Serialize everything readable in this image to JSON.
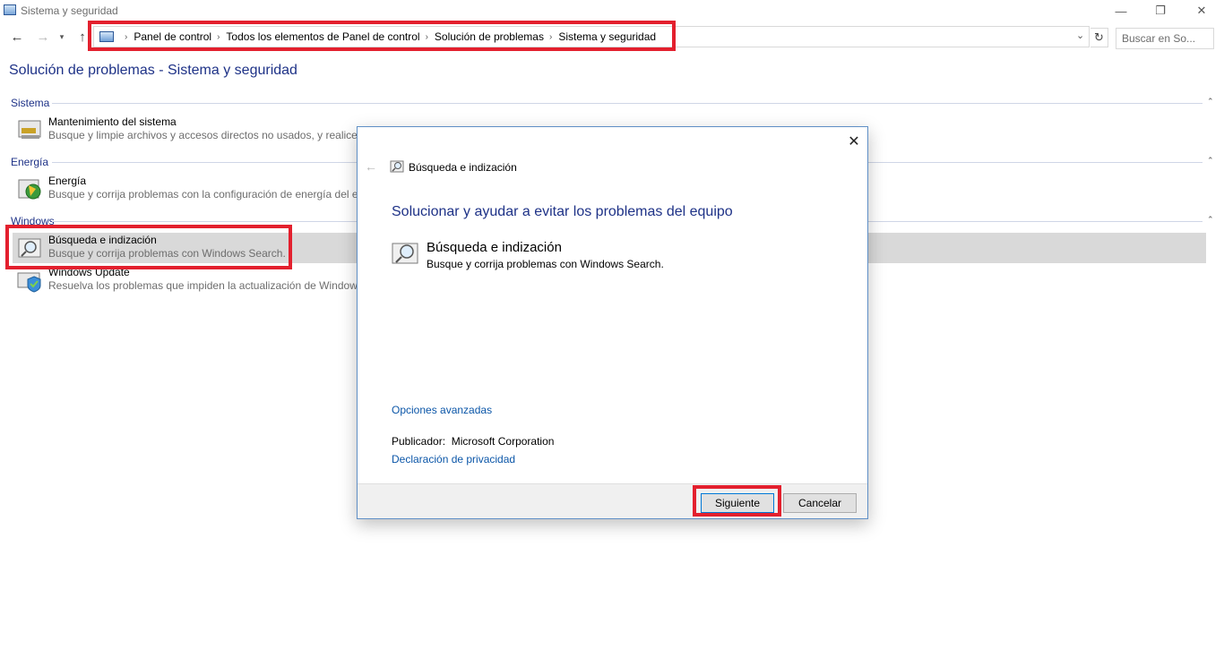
{
  "window": {
    "title": "Sistema y seguridad",
    "minimize_glyph": "—",
    "maximize_glyph": "❐",
    "close_glyph": "✕"
  },
  "navigation": {
    "back_glyph": "←",
    "forward_glyph": "→",
    "recent_glyph": "▾",
    "up_glyph": "↑",
    "breadcrumbs": [
      "Panel de control",
      "Todos los elementos de Panel de control",
      "Solución de problemas",
      "Sistema y seguridad"
    ],
    "breadcrumb_separator": "›",
    "dropdown_glyph": "⌄",
    "refresh_glyph": "↻",
    "search_placeholder": "Buscar en So..."
  },
  "page": {
    "title": "Solución de problemas - Sistema y seguridad",
    "collapse_glyph": "⌃",
    "groups": [
      {
        "heading": "Sistema",
        "items": [
          {
            "name": "Mantenimiento del sistema",
            "description": "Busque y limpie archivos y accesos directos no usados, y realice tareas de mantenimiento.",
            "icon": "maintenance-icon"
          }
        ]
      },
      {
        "heading": "Energía",
        "items": [
          {
            "name": "Energía",
            "description": "Busque y corrija problemas con la configuración de energía del equipo.",
            "icon": "power-icon"
          }
        ]
      },
      {
        "heading": "Windows",
        "items": [
          {
            "name": "Búsqueda e indización",
            "description": "Busque y corrija problemas con Windows Search.",
            "icon": "search-indexing-icon",
            "selected": true
          },
          {
            "name": "Windows Update",
            "description": "Resuelva los problemas que impiden la actualización de Windows.",
            "icon": "windows-update-icon"
          }
        ]
      }
    ]
  },
  "dialog": {
    "close_glyph": "✕",
    "back_glyph": "←",
    "breadcrumb": "Búsqueda e indización",
    "heading": "Solucionar y ayudar a evitar los problemas del equipo",
    "item_name": "Búsqueda e indización",
    "item_description": "Busque y corrija problemas con Windows Search.",
    "advanced_link": "Opciones avanzadas",
    "publisher_label": "Publicador:",
    "publisher_value": "Microsoft Corporation",
    "privacy_link": "Declaración de privacidad",
    "next_button": "Siguiente",
    "cancel_button": "Cancelar"
  },
  "colors": {
    "highlight_red": "#e3202e",
    "heading_blue": "#1e3287",
    "link_blue": "#0b56a8",
    "selected_row": "#d9d9d9"
  }
}
